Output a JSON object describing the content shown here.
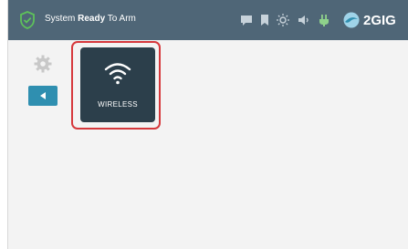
{
  "status_bar": {
    "status_prefix": "System ",
    "status_bold": "Ready",
    "status_suffix": " To Arm",
    "brand": "2GIG",
    "icons": [
      "shield-check-icon",
      "message-icon",
      "bookmark-icon",
      "brightness-icon",
      "volume-icon",
      "power-plug-icon",
      "brand-logo-icon"
    ]
  },
  "sidebar": {
    "icons": [
      "gear-icon",
      "back-arrow-icon"
    ]
  },
  "main": {
    "tiles": [
      {
        "label": "WIRELESS",
        "icon": "wifi-icon",
        "selected": true
      }
    ]
  },
  "colors": {
    "topbar": "#4f6677",
    "accent": "#2f8fb0",
    "tile": "#2c3f4b",
    "selection": "#d6383c",
    "status_ok": "#5ec25a"
  }
}
